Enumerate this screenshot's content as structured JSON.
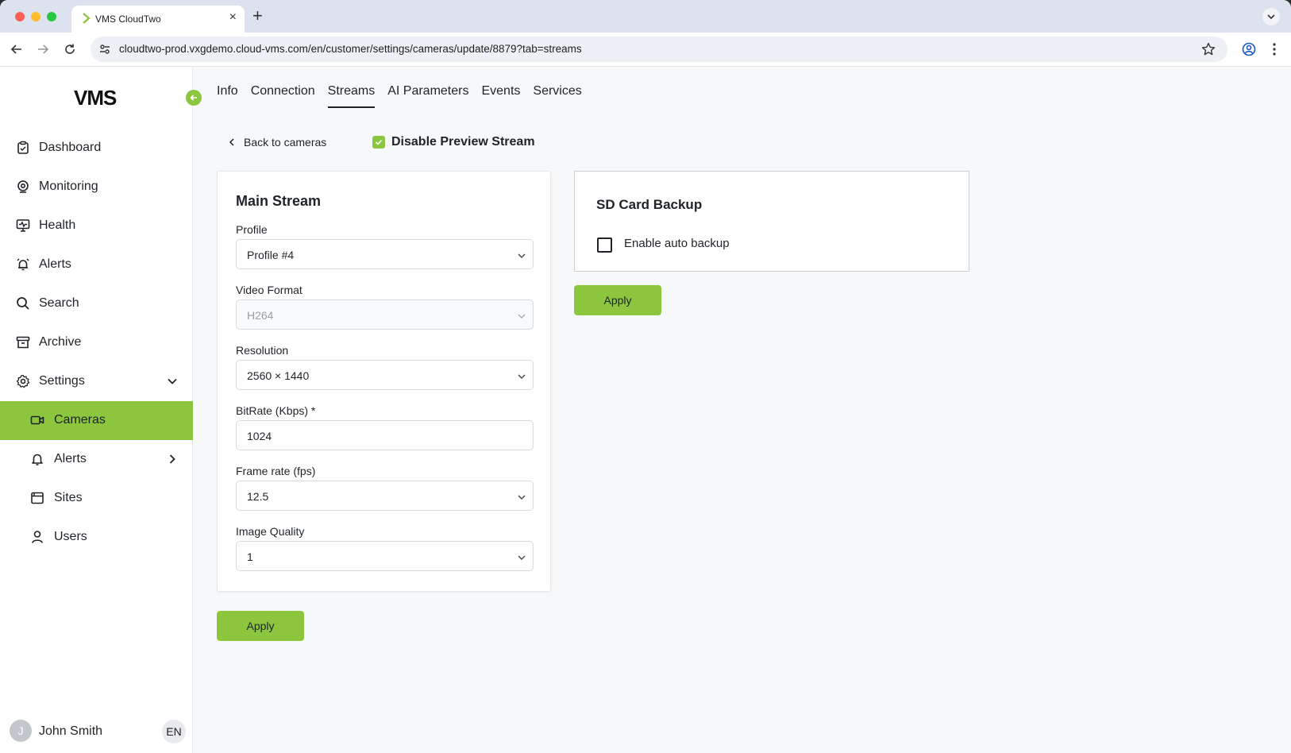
{
  "browser": {
    "tab_title": "VMS CloudTwo",
    "url": "cloudtwo-prod.vxgdemo.cloud-vms.com/en/customer/settings/cameras/update/8879?tab=streams"
  },
  "sidebar": {
    "logo": "VMS",
    "items": [
      {
        "label": "Dashboard"
      },
      {
        "label": "Monitoring"
      },
      {
        "label": "Health"
      },
      {
        "label": "Alerts"
      },
      {
        "label": "Search"
      },
      {
        "label": "Archive"
      },
      {
        "label": "Settings"
      },
      {
        "label": "Cameras"
      },
      {
        "label": "Alerts"
      },
      {
        "label": "Sites"
      },
      {
        "label": "Users"
      }
    ],
    "user": {
      "initial": "J",
      "name": "John Smith",
      "lang": "EN"
    }
  },
  "main": {
    "tabs": [
      {
        "label": "Info"
      },
      {
        "label": "Connection"
      },
      {
        "label": "Streams"
      },
      {
        "label": "AI Parameters"
      },
      {
        "label": "Events"
      },
      {
        "label": "Services"
      }
    ],
    "back_label": "Back to cameras",
    "preview_label": "Disable Preview Stream",
    "stream": {
      "title": "Main Stream",
      "fields": [
        {
          "label": "Profile",
          "value": "Profile #4"
        },
        {
          "label": "Video Format",
          "value": "H264"
        },
        {
          "label": "Resolution",
          "value": "2560 × 1440"
        },
        {
          "label": "BitRate (Kbps) *",
          "value": "1024"
        },
        {
          "label": "Frame rate (fps)",
          "value": "12.5"
        },
        {
          "label": "Image Quality",
          "value": "1"
        }
      ],
      "apply_label": "Apply"
    },
    "sd_backup": {
      "title": "SD Card Backup",
      "checkbox_label": "Enable auto backup",
      "apply_label": "Apply"
    }
  },
  "colors": {
    "accent": "#8cc63f",
    "text": "#1f2328"
  }
}
